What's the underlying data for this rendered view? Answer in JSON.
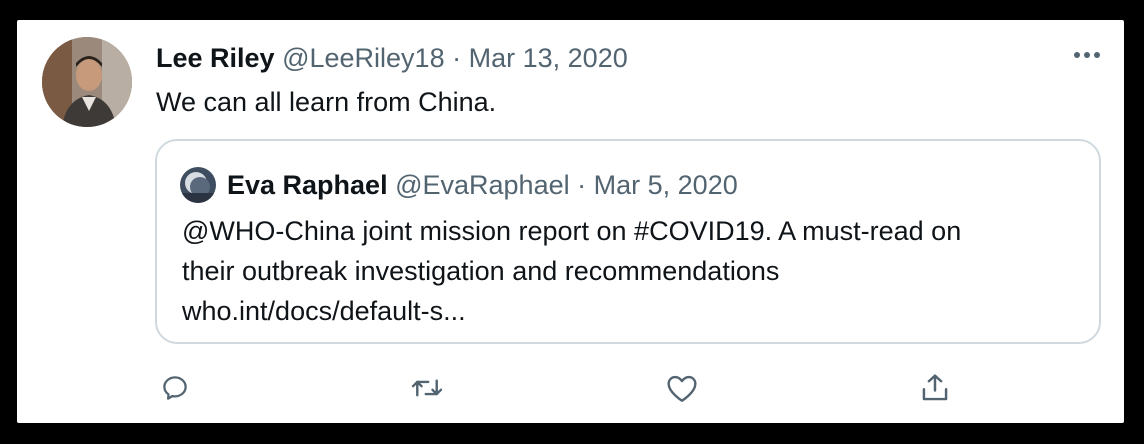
{
  "tweet": {
    "display_name": "Lee Riley",
    "handle": "@LeeRiley18",
    "separator": "·",
    "date": "Mar 13, 2020",
    "text": "We can all learn from China.",
    "avatar_icon": "user-photo-icon",
    "more_icon": "more-horizontal-icon"
  },
  "quoted_tweet": {
    "display_name": "Eva Raphael",
    "handle": "@EvaRaphael",
    "separator": "·",
    "date": "Mar 5, 2020",
    "text_lines": [
      "@WHO-China joint mission report on #COVID19. A must-read on",
      "their outbreak investigation and recommendations",
      "who.int/docs/default-s..."
    ],
    "avatar_icon": "user-photo-icon"
  },
  "actions": {
    "reply_icon": "reply-icon",
    "retweet_icon": "retweet-icon",
    "like_icon": "like-heart-icon",
    "share_icon": "share-icon"
  },
  "colors": {
    "text_primary": "#0f1419",
    "text_secondary": "#536471",
    "border": "#cfd9de",
    "frame_background": "#000000"
  }
}
